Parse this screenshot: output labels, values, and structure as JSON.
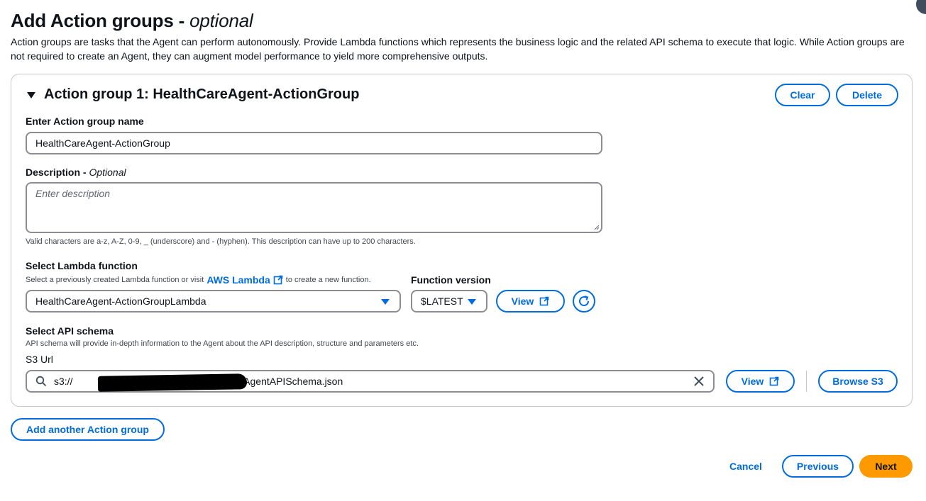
{
  "page": {
    "title": "Add Action groups - ",
    "title_suffix": "optional",
    "description": "Action groups are tasks that the Agent can perform autonomously. Provide Lambda functions which represents the business logic and the related API schema to execute that logic. While Action groups are not required to create an Agent, they can augment model performance to yield more comprehensive outputs."
  },
  "action_group": {
    "title": "Action group 1: HealthCareAgent-ActionGroup",
    "clear_label": "Clear",
    "delete_label": "Delete",
    "name_label": "Enter Action group name",
    "name_value": "HealthCareAgent-ActionGroup",
    "description_label": "Description - ",
    "description_optional": "Optional",
    "description_placeholder": "Enter description",
    "description_hint": "Valid characters are a-z, A-Z, 0-9, _ (underscore) and - (hyphen). This description can have up to 200 characters.",
    "lambda_label": "Select Lambda function",
    "lambda_hint_prefix": "Select a previously created Lambda function or visit",
    "lambda_link": "AWS Lambda",
    "lambda_hint_suffix": "to create a new function.",
    "lambda_value": "HealthCareAgent-ActionGroupLambda",
    "version_label": "Function version",
    "version_value": "$LATEST",
    "view_label": "View",
    "schema_label": "Select API schema",
    "schema_hint": "API schema will provide in-depth information to the Agent about the API description, structure and parameters etc.",
    "s3_url_label": "S3 Url",
    "s3_prefix": "s3://",
    "s3_suffix": "/HealthCareAgentAPISchema.json",
    "schema_view_label": "View",
    "browse_label": "Browse S3"
  },
  "footer": {
    "add_group_label": "Add another Action group",
    "cancel_label": "Cancel",
    "previous_label": "Previous",
    "next_label": "Next"
  },
  "colors": {
    "accent": "#006ce0",
    "primary": "#ff9900",
    "border": "#8c8c94"
  },
  "icons": [
    "caret-down-icon",
    "external-link-icon",
    "refresh-icon",
    "search-icon",
    "clear-icon",
    "dropdown-caret-icon"
  ]
}
